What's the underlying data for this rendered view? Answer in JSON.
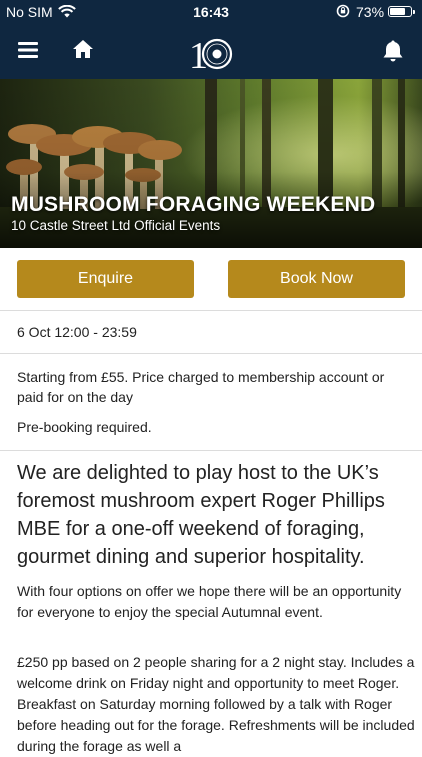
{
  "status_bar": {
    "carrier": "No SIM",
    "time": "16:43",
    "battery": "73%",
    "battery_level": 0.73
  },
  "nav": {
    "logo_text": "10"
  },
  "event": {
    "title": "MUSHROOM FORAGING WEEKEND",
    "organizer": "10 Castle Street Ltd Official Events",
    "enquire_label": "Enquire",
    "book_label": "Book Now",
    "datetime": "6 Oct 12:00 - 23:59",
    "price": "Starting from £55. Price charged to membership account or paid for on the day",
    "prebooking": "Pre-booking required.",
    "lead": "We are delighted to play host to the UK’s foremost mushroom expert Roger Phillips MBE for a one-off weekend of foraging, gourmet dining and superior hospitality.",
    "paragraph1": "With four options on offer we hope there will be an opportunity for everyone to enjoy the special Autumnal event.",
    "paragraph2": "£250 pp based on 2 people sharing for a 2 night stay. Includes a welcome drink on Friday night and opportunity to meet Roger. Breakfast on Saturday morning followed by a talk with Roger before heading out for the forage. Refreshments will be included during the forage as well a"
  },
  "icons": {
    "menu": "hamburger-icon",
    "home": "home-icon",
    "notifications": "bell-icon",
    "wifi": "wifi-icon",
    "rotation_lock": "rotation-lock-icon",
    "battery": "battery-icon"
  },
  "colors": {
    "header": "#0f2740",
    "button": "#b5891c",
    "text": "#222222"
  }
}
